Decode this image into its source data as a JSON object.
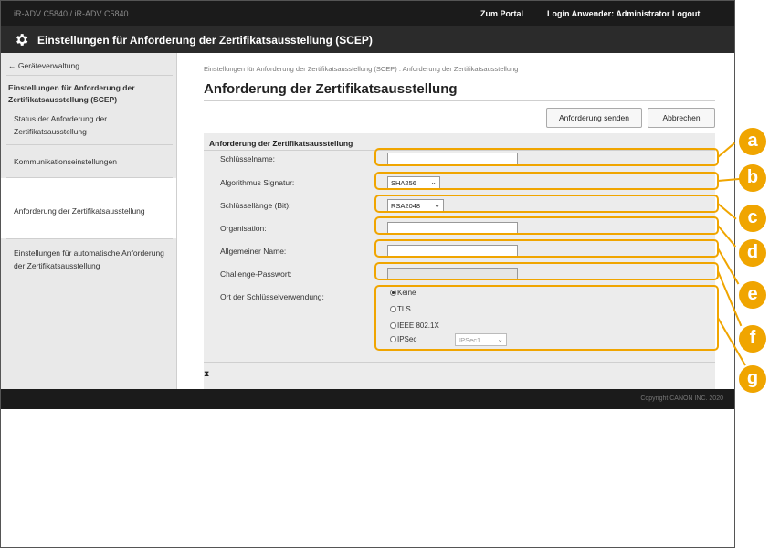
{
  "topbar": {
    "device_name": "iR-ADV C5840 / iR-ADV C5840",
    "portal_link": "Zum Portal",
    "login_label": "Login Anwender:",
    "login_user": "Administrator",
    "logout_link": "Logout"
  },
  "titlebar": {
    "title": "Einstellungen für Anforderung der Zertifikatsausstellung (SCEP)"
  },
  "sidebar": {
    "back_link": "Geräteverwaltung",
    "section_title": "Einstellungen für Anforderung der Zertifikatsausstellung (SCEP)",
    "items": [
      {
        "label": "Status der Anforderung der Zertifikatsausstellung"
      },
      {
        "label": "Kommunikationseinstellungen"
      },
      {
        "label": "Anforderung der Zertifikatsausstellung"
      },
      {
        "label": "Einstellungen für automatische Anforderung der Zertifikatsausstellung"
      }
    ]
  },
  "main": {
    "breadcrumb": "Einstellungen für Anforderung der Zertifikatsausstellung (SCEP) : Anforderung der Zertifikatsausstellung",
    "heading": "Anforderung der Zertifikatsausstellung",
    "send_button": "Anforderung senden",
    "cancel_button": "Abbrechen",
    "panel_title": "Anforderung der Zertifikatsausstellung",
    "fields": {
      "key_name": {
        "label": "Schlüsselname:",
        "value": ""
      },
      "signature_algorithm": {
        "label": "Algorithmus Signatur:",
        "value": "SHA256"
      },
      "key_length": {
        "label": "Schlüssellänge (Bit):",
        "value": "RSA2048"
      },
      "organization": {
        "label": "Organisation:",
        "value": ""
      },
      "common_name": {
        "label": "Allgemeiner Name:",
        "value": ""
      },
      "challenge_password": {
        "label": "Challenge-Passwort:",
        "value": ""
      },
      "key_usage": {
        "label": "Ort der Schlüsselverwendung:",
        "options": [
          "Keine",
          "TLS",
          "IEEE 802.1X",
          "IPSec"
        ],
        "selected": "Keine",
        "ipsec_select": "IPSec1"
      }
    }
  },
  "footer": {
    "copyright": "Copyright CANON INC. 2020"
  },
  "callouts": [
    "a",
    "b",
    "c",
    "d",
    "e",
    "f",
    "g"
  ],
  "colors": {
    "accent": "#f0a500",
    "topbar": "#1b1b1b",
    "titlebar": "#2b2b2b",
    "sidebar": "#e9e9e9",
    "panel": "#ececec"
  }
}
